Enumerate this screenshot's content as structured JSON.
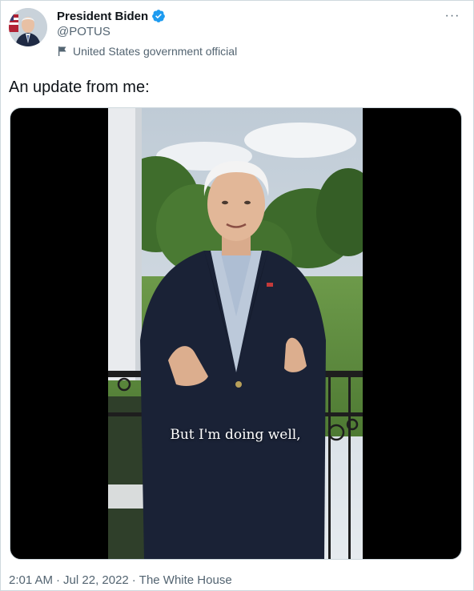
{
  "author": {
    "display_name": "President Biden",
    "handle": "@POTUS",
    "label": "United States government official",
    "verified_icon": "verified-badge-icon",
    "label_icon": "flag-icon"
  },
  "tweet": {
    "text": "An update from me:"
  },
  "media": {
    "caption": "But I'm doing well,"
  },
  "meta": {
    "time": "2:01 AM",
    "date": "Jul 22, 2022",
    "source": "The White House",
    "separator": "·"
  },
  "menu": {
    "more_label": "···"
  },
  "colors": {
    "text_primary": "#0f1419",
    "text_secondary": "#536471",
    "verified_blue": "#1d9bf0",
    "border": "#cfd9de"
  }
}
